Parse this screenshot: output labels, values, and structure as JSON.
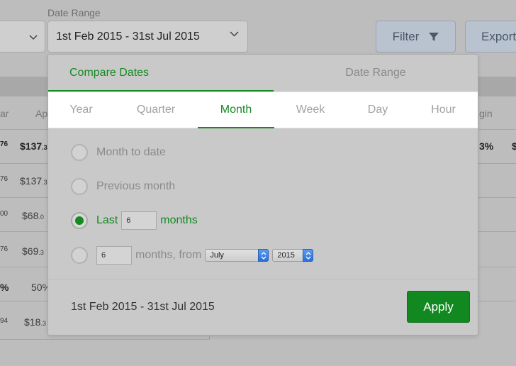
{
  "background": {
    "date_range_label": "Date Range",
    "date_range_value": "1st Feb 2015 - 31st Jul 2015",
    "filter_label": "Filter",
    "export_label": "Export",
    "headers": {
      "left": "ar",
      "ap": "Ap",
      "right": "gin"
    },
    "rows": [
      {
        "left": "76",
        "ap_main": "$137",
        "ap_small": ".3",
        "right": "3%",
        "right2": "$",
        "bold": true
      },
      {
        "left": "76",
        "ap_main": "$137",
        "ap_small": ".3"
      },
      {
        "left": "00",
        "ap_main": "$68",
        "ap_small": ".0"
      },
      {
        "left": "76",
        "ap_main": "$69",
        "ap_small": ".3"
      },
      {
        "left": "%",
        "ap_main": "50%",
        "ap_small": ""
      },
      {
        "left": "94",
        "ap_main": "$18",
        "ap_small": ".3"
      }
    ]
  },
  "popup": {
    "tabs": [
      "Compare Dates",
      "Date Range"
    ],
    "active_tab": 0,
    "granularity": [
      "Year",
      "Quarter",
      "Month",
      "Week",
      "Day",
      "Hour"
    ],
    "active_granularity": 2,
    "options": {
      "month_to_date": "Month to date",
      "previous_month": "Previous month",
      "last_prefix": "Last",
      "last_value": "6",
      "last_suffix": "months",
      "from_value": "6",
      "from_text": "months, from",
      "from_month": "July",
      "from_year": "2015"
    },
    "selected_option": "last_n_months",
    "footer_range": "1st Feb 2015 - 31st Jul 2015",
    "apply_label": "Apply"
  },
  "colors": {
    "accent": "#158a22",
    "apply_button": "#128920"
  }
}
